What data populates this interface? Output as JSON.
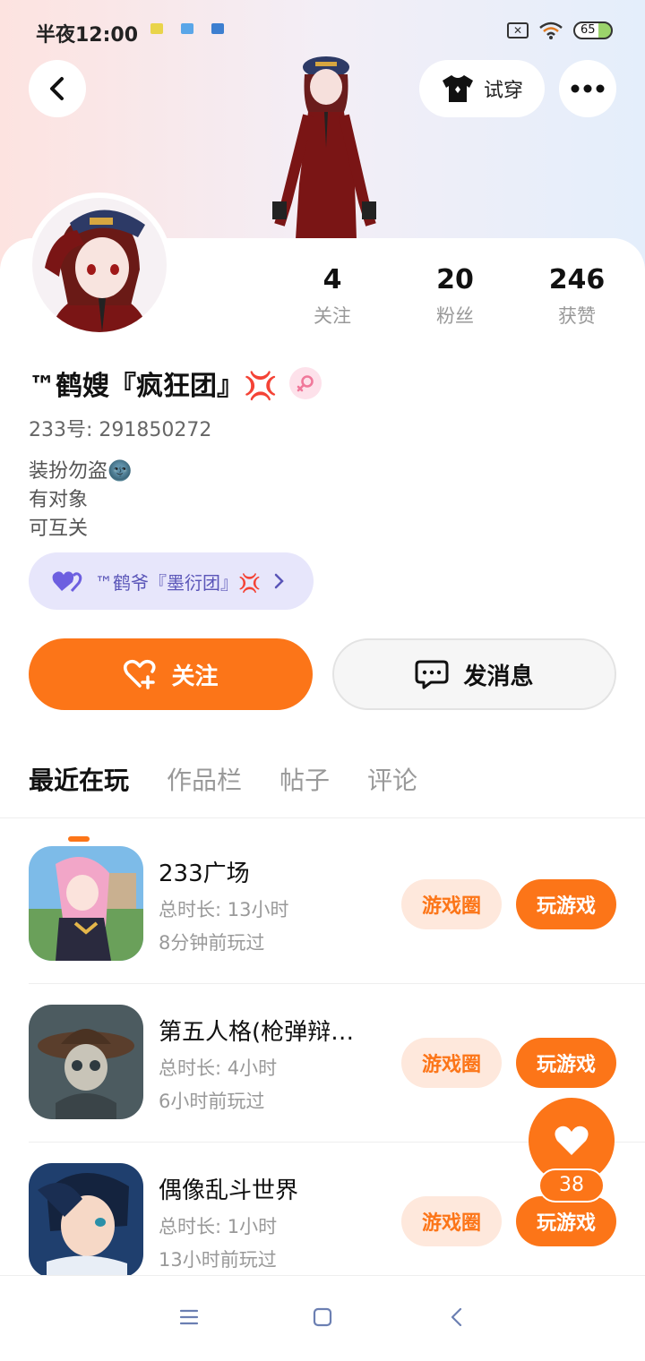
{
  "status_bar": {
    "time": "半夜12:00",
    "battery": "65"
  },
  "header": {
    "try_on_label": "试穿"
  },
  "profile": {
    "stats": [
      {
        "value": "4",
        "label": "关注"
      },
      {
        "value": "20",
        "label": "粉丝"
      },
      {
        "value": "246",
        "label": "获赞"
      }
    ],
    "name": "™鹤嫂『疯狂团』💢",
    "uid": "233号: 291850272",
    "bio": [
      "装扮勿盗🌚",
      "有对象",
      "可互关"
    ],
    "couple_name": "™鹤爷『墨衍团』💢"
  },
  "actions": {
    "follow_label": "关注",
    "message_label": "发消息"
  },
  "tabs": [
    "最近在玩",
    "作品栏",
    "帖子",
    "评论"
  ],
  "games": [
    {
      "name": "233广场",
      "playtime": "总时长: 13小时",
      "last_played": "8分钟前玩过"
    },
    {
      "name": "第五人格(枪弹辩…",
      "playtime": "总时长: 4小时",
      "last_played": "6小时前玩过"
    },
    {
      "name": "偶像乱斗世界",
      "playtime": "总时长: 1小时",
      "last_played": "13小时前玩过"
    }
  ],
  "game_actions": {
    "circle_label": "游戏圈",
    "play_label": "玩游戏"
  },
  "fab": {
    "count": "38"
  },
  "colors": {
    "accent": "#fc7518",
    "couple_bg": "#e7e6fb"
  }
}
